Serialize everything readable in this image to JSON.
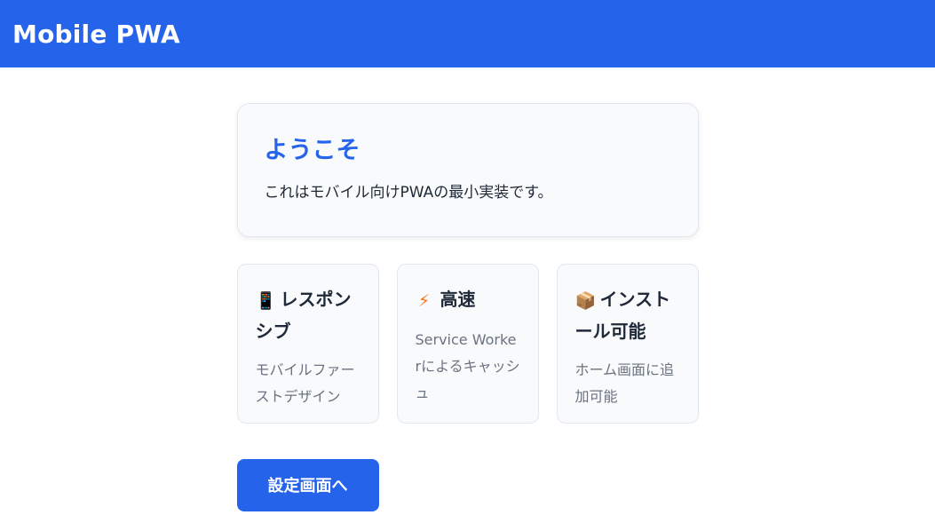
{
  "header": {
    "title": "Mobile PWA"
  },
  "welcome": {
    "title": "ようこそ",
    "text": "これはモバイル向けPWAの最小実装です。"
  },
  "features": [
    {
      "icon": "📱",
      "icon_name": "mobile-phone-icon",
      "title": "レスポンシブ",
      "description": "モバイルファーストデザイン"
    },
    {
      "icon": "⚡",
      "icon_name": "lightning-icon",
      "title": "高速",
      "description": "Service Workerによるキャッシュ"
    },
    {
      "icon": "📦",
      "icon_name": "package-icon",
      "title": "インストール可能",
      "description": "ホーム画面に追加可能"
    }
  ],
  "actions": {
    "settings_label": "設定画面へ"
  },
  "colors": {
    "primary": "#2563eb",
    "card_background": "#f8fafc",
    "card_border": "#e2e8f0",
    "muted_text": "#6b7280"
  }
}
